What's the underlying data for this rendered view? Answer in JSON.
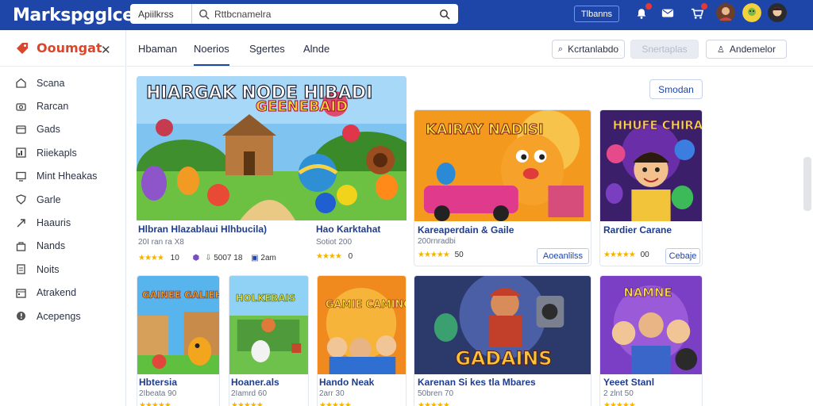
{
  "topbar": {
    "brand": "Markspgglce",
    "search_category": "Apiilkrss",
    "search_query": "Rttbcnamelra",
    "sign_in_label": "Tlbanns",
    "icons": [
      "search-icon",
      "notification-icon",
      "message-icon",
      "cart-icon"
    ]
  },
  "sidebar": {
    "title": "Ooumgat",
    "items": [
      {
        "label": "Scana",
        "icon": "home-icon"
      },
      {
        "label": "Rarcan",
        "icon": "camera-icon"
      },
      {
        "label": "Gads",
        "icon": "gamepad-icon"
      },
      {
        "label": "Riiekapls",
        "icon": "chart-icon"
      },
      {
        "label": "Mint Hheakas",
        "icon": "monitor-icon"
      },
      {
        "label": "Garle",
        "icon": "shield-icon"
      },
      {
        "label": "Haauris",
        "icon": "arrow-icon"
      },
      {
        "label": "Nands",
        "icon": "bag-icon"
      },
      {
        "label": "Noits",
        "icon": "note-icon"
      },
      {
        "label": "Atrakend",
        "icon": "calendar-icon"
      },
      {
        "label": "Acepengs",
        "icon": "settings-icon"
      }
    ]
  },
  "tabs": [
    {
      "label": "Hbaman"
    },
    {
      "label": "Noerios"
    },
    {
      "label": "Sgertes"
    },
    {
      "label": "Alnde"
    }
  ],
  "actions": {
    "first": "Kcrtanlabdo",
    "second": "Snertaplas",
    "third": "Andemelor"
  },
  "sort_label": "Smodan",
  "cards_row1": [
    {
      "title": "Hlbran Hlazablaui Hlhbucila)",
      "sub": "20I ran ra X8",
      "rating": "10",
      "extra1": "5007 18",
      "extra2": "2am"
    },
    {
      "title": "Hao Karktahat",
      "sub": "Sotiot 200",
      "rating": "0"
    },
    {
      "title": "Kareaperdain & Gaile",
      "sub": "200rnradbi",
      "rating": "50",
      "button": "Aoeanlilss"
    },
    {
      "title": "Rardier Carane",
      "sub": "",
      "rating": "00",
      "button": "Cebaje"
    }
  ],
  "cards_row2": [
    {
      "title": "Hbtersia",
      "sub": "2Ibeata 90"
    },
    {
      "title": "Hoaner.als",
      "sub": "2Iamrd 60"
    },
    {
      "title": "Hando Neak",
      "sub": "2arr 30"
    },
    {
      "title": "Karenan Si kes tla Mbares",
      "sub": "50bren 70"
    },
    {
      "title": "Yeeet Stanl",
      "sub": "2 zlnt 50"
    }
  ],
  "banner_text": {
    "line1": "HIARGAK NODE HIBADI",
    "line2": "GEENEBAID"
  },
  "art_text": {
    "card3": "KAIRAY NADISI",
    "card4": "HHUFE CHIRAY",
    "r2c1": "GAINEE GALIEHS",
    "r2c2": "HOLKEBAIS",
    "r2c3": "GAMIE CAMING",
    "r2c4": "GADAINS",
    "r2c5": "NAMNE"
  },
  "colors": {
    "brand": "#1e45a8",
    "accent": "#d9462b",
    "star": "#f4b400"
  }
}
